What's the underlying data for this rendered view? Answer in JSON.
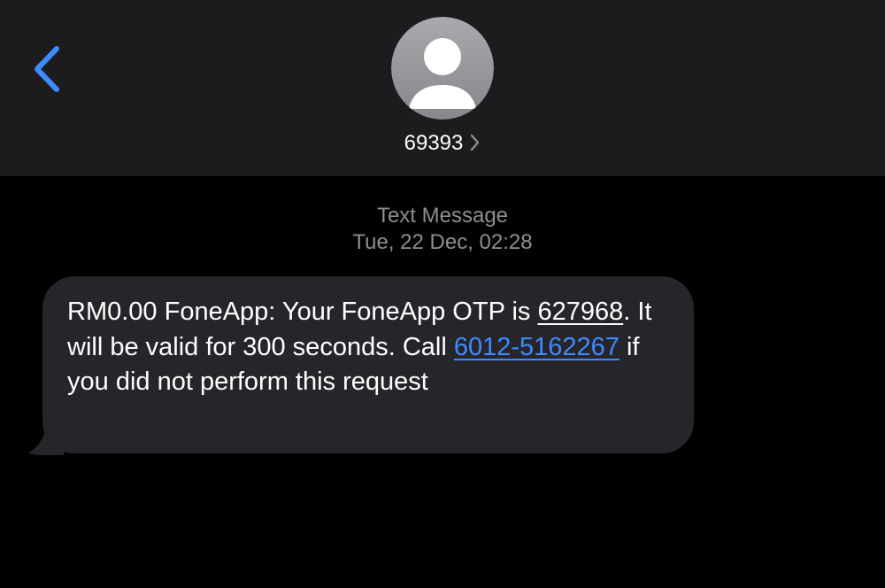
{
  "header": {
    "back_icon": "chevron-left-icon",
    "avatar_icon": "person-silhouette-icon",
    "contact_name": "69393",
    "contact_chevron_icon": "chevron-right-icon"
  },
  "thread": {
    "label": "Text Message",
    "timestamp": "Tue, 22 Dec, 02:28"
  },
  "message": {
    "direction": "incoming",
    "text_before_otp": "RM0.00 FoneApp: Your FoneApp OTP is ",
    "otp_code": "627968",
    "text_after_otp": ". It will be valid for 300 seconds. Call ",
    "phone_number": "6012-5162267",
    "text_after_phone": " if you did not perform this request"
  },
  "colors": {
    "background": "#000000",
    "header_background": "#1c1c1e",
    "accent_blue": "#3d8bff",
    "bubble_background": "#26252a",
    "meta_text": "#8e8e93",
    "avatar_background": "#a2a2a7"
  }
}
